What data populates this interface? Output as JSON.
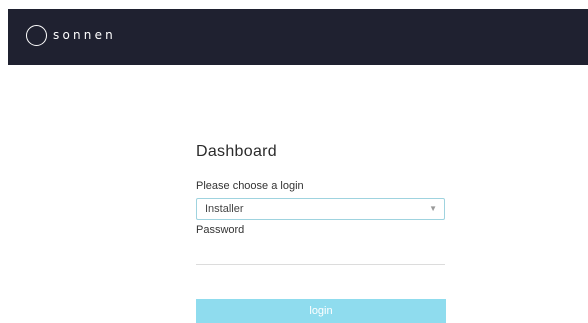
{
  "header": {
    "logo_text": "sonnen"
  },
  "main": {
    "title": "Dashboard",
    "login_label": "Please choose a login",
    "login_selected": "Installer",
    "password_label": "Password",
    "password_value": "",
    "login_button": "login"
  },
  "colors": {
    "header_bg": "#1f2130",
    "button_bg": "#8fdcee",
    "select_border": "#9fd3df"
  },
  "icons": {
    "logo": "circle-logo-icon",
    "dropdown": "triangle-down-icon"
  }
}
